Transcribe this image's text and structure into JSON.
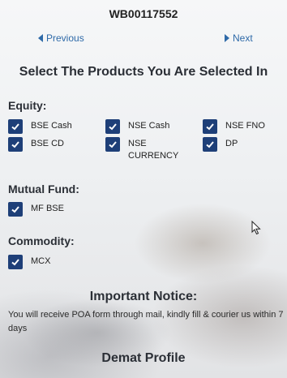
{
  "header": {
    "code": "WB00117552",
    "prev_label": "Previous",
    "next_label": "Next"
  },
  "main": {
    "title": "Select The Products You Are Selected In",
    "equity": {
      "label": "Equity:",
      "options": [
        "BSE Cash",
        "NSE Cash",
        "NSE FNO",
        "BSE CD",
        "NSE CURRENCY",
        "DP"
      ]
    },
    "mutual_fund": {
      "label": "Mutual Fund:",
      "options": [
        "MF BSE"
      ]
    },
    "commodity": {
      "label": "Commodity:",
      "options": [
        "MCX"
      ]
    },
    "notice": {
      "title": "Important Notice:",
      "text": "You will receive POA form through mail, kindly fill & courier us within 7 days"
    },
    "demat_title": "Demat Profile"
  },
  "colors": {
    "checkbox": "#1e3f78",
    "link": "#2e6aa8"
  },
  "icons": {
    "check": "check-icon",
    "prev": "triangle-left-icon",
    "next": "triangle-right-icon",
    "cursor": "mouse-cursor-icon"
  }
}
